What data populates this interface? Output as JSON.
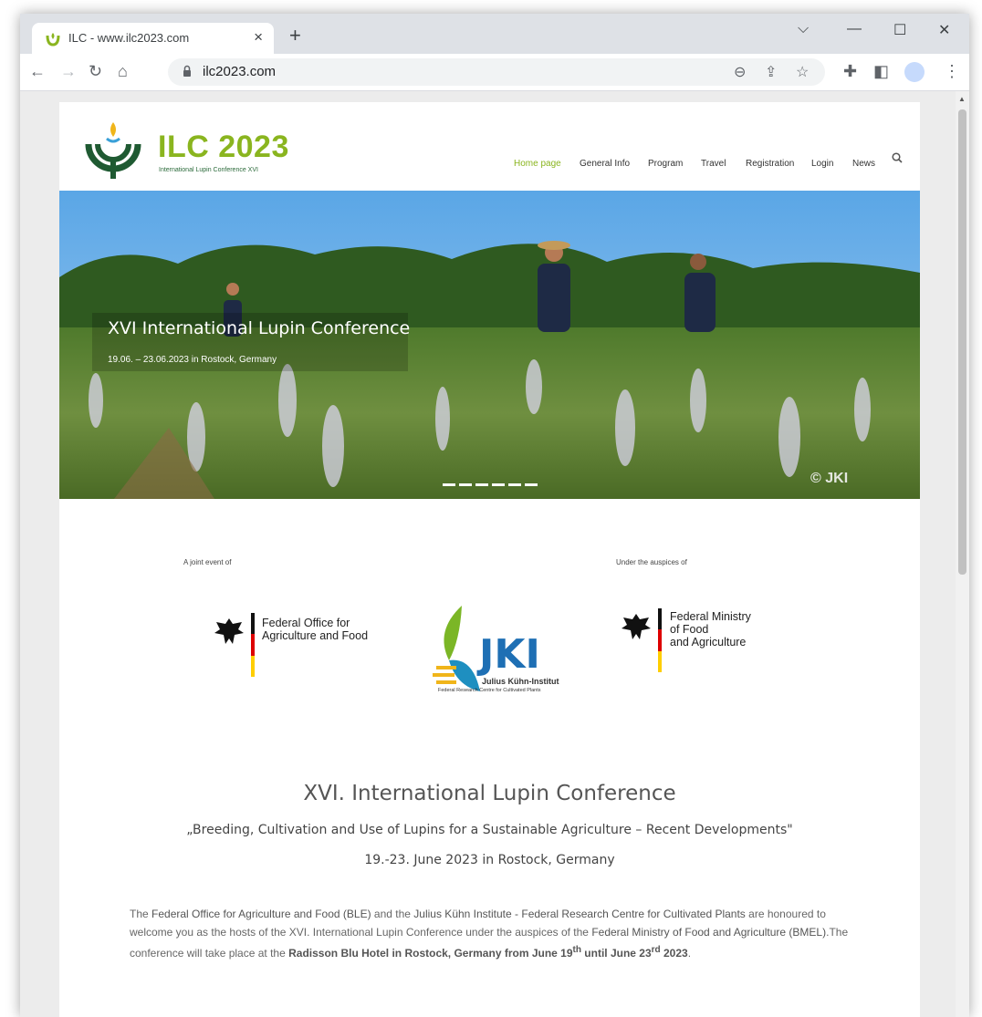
{
  "browser": {
    "tab_title": "ILC - www.ilc2023.com",
    "url": "ilc2023.com"
  },
  "site": {
    "logo_title": "ILC 2023",
    "logo_subtitle": "International Lupin Conference XVI",
    "nav": [
      "Home page",
      "General Info",
      "Program",
      "Travel",
      "Registration",
      "Login",
      "News"
    ],
    "brand_color": "#8ab51f"
  },
  "hero": {
    "title": "XVI International Lupin Conference",
    "subtitle": "19.06. – 23.06.2023 in Rostock, Germany",
    "credit": "© JKI"
  },
  "partners": {
    "joint_label": "A joint event of",
    "auspices_label": "Under the auspices of",
    "ble_line1": "Federal Office for",
    "ble_line2": "Agriculture and Food",
    "jki_name": "Julius Kühn-Institut",
    "jki_sub": "Federal Research Centre for Cultivated Plants",
    "bmel_line1": "Federal Ministry",
    "bmel_line2": "of Food",
    "bmel_line3": "and Agriculture"
  },
  "content": {
    "heading": "XVI. International Lupin Conference",
    "motto": "„Breeding, Cultivation and Use of Lupins for a Sustainable Agriculture – Recent Developments\"",
    "date": "19.-23. June 2023 in Rostock, Germany",
    "para_1": "The ",
    "para_ble": "Federal Office for Agriculture and Food (BLE)",
    "para_2": " and the ",
    "para_jki": "Julius Kühn Institute - Federal Research Centre for Cultivated Plants",
    "para_3": " are honoured to welcome you as the hosts of the XVI. International Lupin Conference under the auspices of the ",
    "para_bmel": "Federal Ministry of Food and Agriculture (BMEL)",
    "para_4": ".The conference will take place at the ",
    "para_hotel": "Radisson Blu Hotel in Rostock, Germany from June 19",
    "para_sup1": "th",
    "para_until": " until June 23",
    "para_sup2": "rd",
    "para_year": " 2023",
    "para_end": "."
  }
}
